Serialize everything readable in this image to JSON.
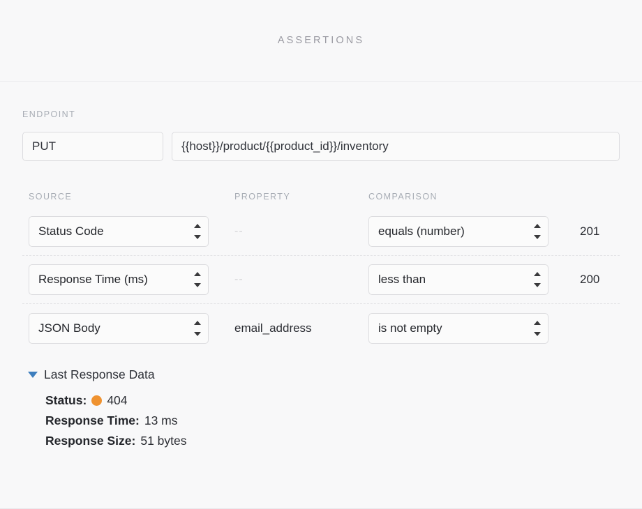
{
  "header": {
    "title": "ASSERTIONS"
  },
  "endpoint": {
    "label": "ENDPOINT",
    "method": "PUT",
    "url": "{{host}}/product/{{product_id}}/inventory"
  },
  "columns": {
    "source": "SOURCE",
    "property": "PROPERTY",
    "comparison": "COMPARISON"
  },
  "assertions": [
    {
      "source": "Status Code",
      "property": "--",
      "property_empty": true,
      "comparison": "equals (number)",
      "value": "201"
    },
    {
      "source": "Response Time (ms)",
      "property": "--",
      "property_empty": true,
      "comparison": "less than",
      "value": "200"
    },
    {
      "source": "JSON Body",
      "property": "email_address",
      "property_empty": false,
      "comparison": "is not empty",
      "value": ""
    }
  ],
  "last_response": {
    "title": "Last Response Data",
    "expanded": true,
    "status_label": "Status:",
    "status_value": "404",
    "status_color": "#ef9230",
    "time_label": "Response Time:",
    "time_value": "13 ms",
    "size_label": "Response Size:",
    "size_value": "51 bytes"
  },
  "colors": {
    "background": "#f8f8f9",
    "accent_blue": "#3d7ebe",
    "status_orange": "#ef9230",
    "label_gray": "#a8adb5"
  }
}
